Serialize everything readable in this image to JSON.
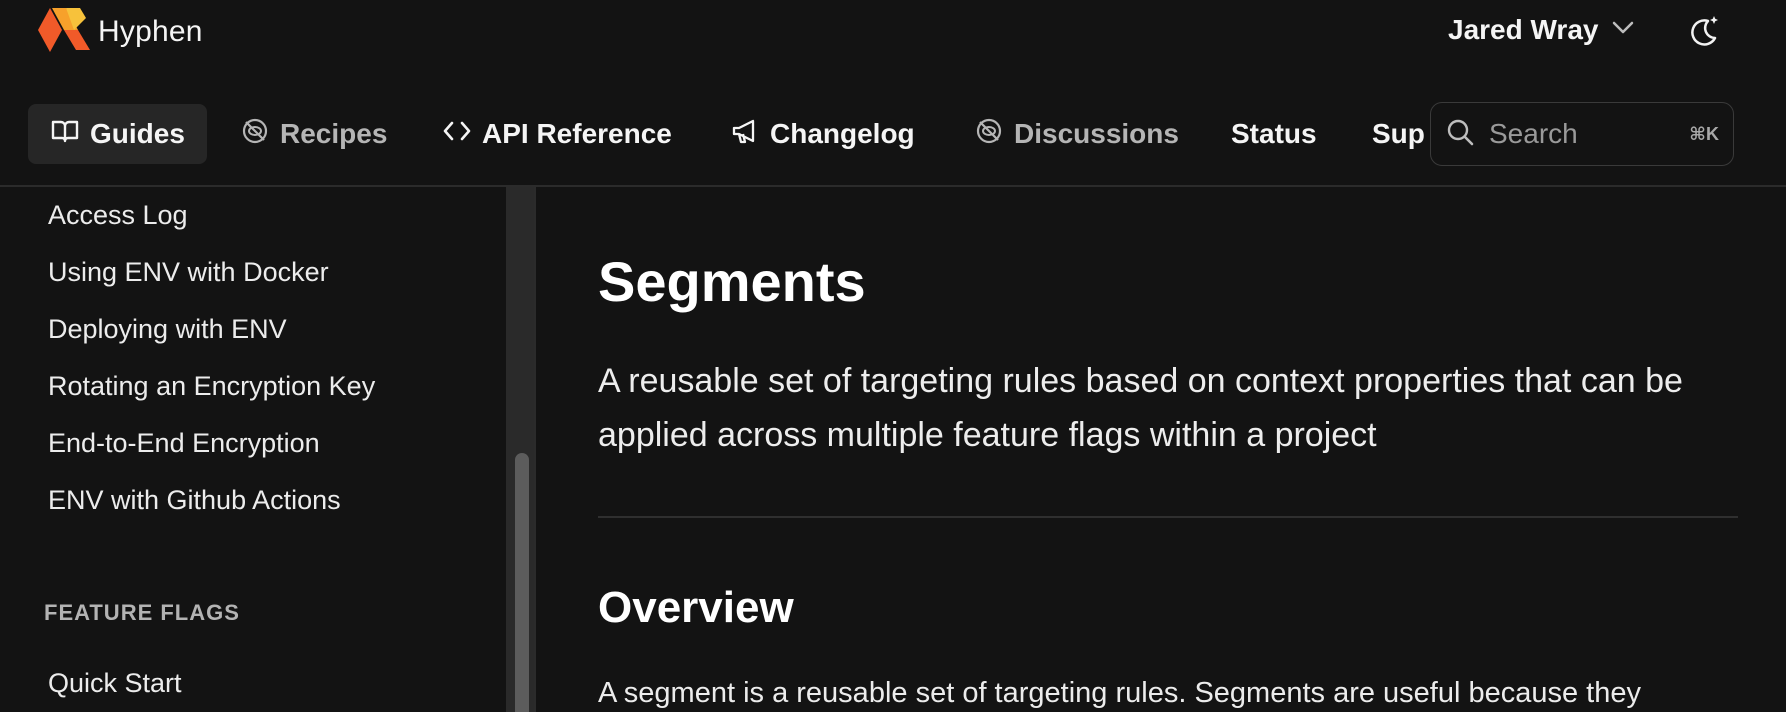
{
  "brand": {
    "name": "Hyphen",
    "logo_colors": [
      "#f15a29",
      "#f7b733"
    ]
  },
  "user": {
    "name": "Jared Wray"
  },
  "nav": {
    "tabs": [
      {
        "label": "Guides",
        "icon": "book-open-icon",
        "active": true
      },
      {
        "label": "Recipes",
        "icon": "eye-off-icon",
        "muted": true
      },
      {
        "label": "API Reference",
        "icon": "code-icon"
      },
      {
        "label": "Changelog",
        "icon": "megaphone-icon"
      },
      {
        "label": "Discussions",
        "icon": "eye-off-icon",
        "muted": true
      },
      {
        "label": "Status"
      },
      {
        "label": "Sup"
      }
    ],
    "search": {
      "placeholder": "Search",
      "shortcut": "⌘K"
    }
  },
  "sidebar": {
    "items": [
      "Access Log",
      "Using ENV with Docker",
      "Deploying with ENV",
      "Rotating an Encryption Key",
      "End-to-End Encryption",
      "ENV with Github Actions"
    ],
    "section": "FEATURE FLAGS",
    "section_items": [
      "Quick Start"
    ]
  },
  "main": {
    "title": "Segments",
    "lead": "A reusable set of targeting rules based on context properties that can be applied across multiple feature flags within a project",
    "overview_heading": "Overview",
    "overview_text": "A segment is a reusable set of targeting rules. Segments are useful because they"
  },
  "colors": {
    "background": "#131313",
    "active_tab": "#262626",
    "muted_text": "#b5b5b5"
  }
}
